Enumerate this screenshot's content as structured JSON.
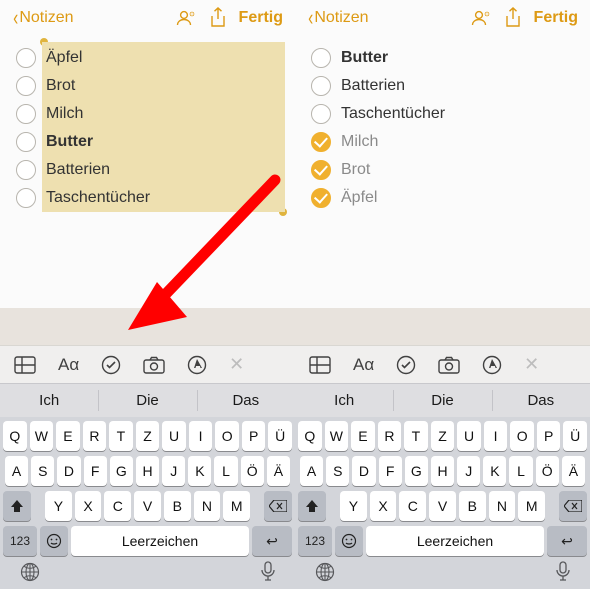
{
  "tint": "#dd9a14",
  "nav": {
    "back": "Notizen",
    "done": "Fertig"
  },
  "left_list": [
    {
      "label": "Äpfel",
      "checked": false,
      "bold": false
    },
    {
      "label": "Brot",
      "checked": false,
      "bold": false
    },
    {
      "label": "Milch",
      "checked": false,
      "bold": false
    },
    {
      "label": "Butter",
      "checked": false,
      "bold": true
    },
    {
      "label": "Batterien",
      "checked": false,
      "bold": false
    },
    {
      "label": "Taschentücher",
      "checked": false,
      "bold": false
    }
  ],
  "right_list": [
    {
      "label": "Butter",
      "checked": false,
      "bold": true
    },
    {
      "label": "Batterien",
      "checked": false,
      "bold": false
    },
    {
      "label": "Taschentücher",
      "checked": false,
      "bold": false
    },
    {
      "label": "Milch",
      "checked": true,
      "bold": false
    },
    {
      "label": "Brot",
      "checked": true,
      "bold": false
    },
    {
      "label": "Äpfel",
      "checked": true,
      "bold": false
    }
  ],
  "fmt_icons": [
    "table",
    "text-format",
    "checklist",
    "camera",
    "markup",
    "close"
  ],
  "predictions": [
    "Ich",
    "Die",
    "Das"
  ],
  "keyboard": {
    "row1": [
      "Q",
      "W",
      "E",
      "R",
      "T",
      "Z",
      "U",
      "I",
      "O",
      "P",
      "Ü"
    ],
    "row2": [
      "A",
      "S",
      "D",
      "F",
      "G",
      "H",
      "J",
      "K",
      "L",
      "Ö",
      "Ä"
    ],
    "row3": [
      "Y",
      "X",
      "C",
      "V",
      "B",
      "N",
      "M"
    ],
    "numkey": "123",
    "space": "Leerzeichen"
  }
}
